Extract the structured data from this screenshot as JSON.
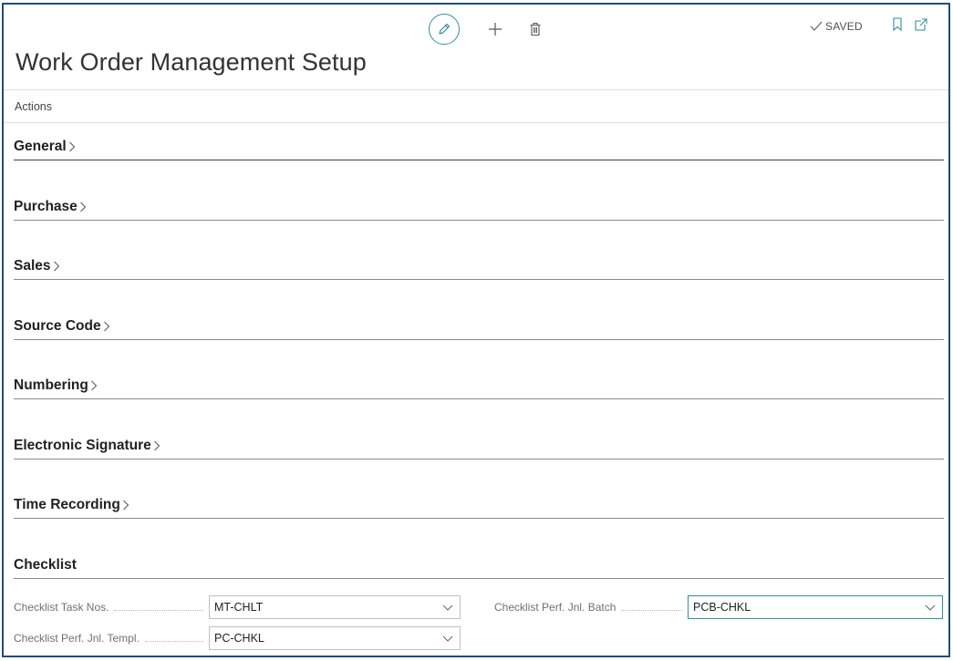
{
  "toolbar": {
    "edit_icon": "pencil-icon",
    "new_icon": "plus-icon",
    "delete_icon": "trash-icon",
    "status_text": "SAVED",
    "bookmark_icon": "bookmark-icon",
    "popout_icon": "popout-icon"
  },
  "page": {
    "title": "Work Order Management Setup",
    "actions_label": "Actions"
  },
  "sections": [
    {
      "label": "General"
    },
    {
      "label": "Purchase"
    },
    {
      "label": "Sales"
    },
    {
      "label": "Source Code"
    },
    {
      "label": "Numbering"
    },
    {
      "label": "Electronic Signature"
    },
    {
      "label": "Time Recording"
    },
    {
      "label": "Checklist"
    }
  ],
  "checklist": {
    "task_nos": {
      "label": "Checklist Task Nos.",
      "value": "MT-CHLT"
    },
    "jnl_templ": {
      "label": "Checklist Perf. Jnl. Templ.",
      "value": "PC-CHKL"
    },
    "jnl_batch": {
      "label": "Checklist Perf. Jnl. Batch",
      "value": "PCB-CHKL"
    }
  },
  "colors": {
    "accent": "#2f8f9d",
    "frame": "#1f4e79"
  }
}
